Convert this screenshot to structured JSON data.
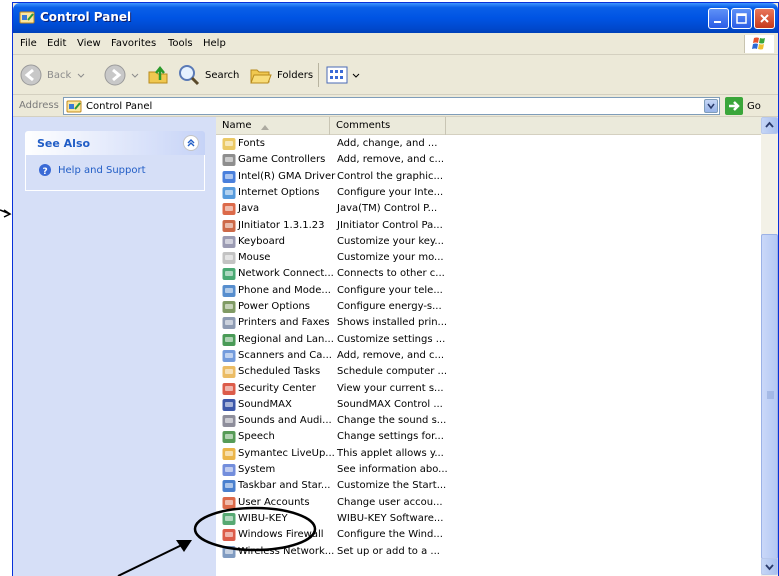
{
  "window": {
    "title": "Control Panel"
  },
  "menu": [
    "File",
    "Edit",
    "View",
    "Favorites",
    "Tools",
    "Help"
  ],
  "toolbar": {
    "back": "Back",
    "search": "Search",
    "folders": "Folders"
  },
  "address": {
    "label": "Address",
    "value": "Control Panel",
    "go": "Go"
  },
  "see_also": {
    "title": "See Also",
    "links": [
      "Help and Support"
    ]
  },
  "columns": {
    "name": "Name",
    "comments": "Comments"
  },
  "items": [
    {
      "name": "Fonts",
      "comment": "Add, change, and ...",
      "icon": "fonts-icon",
      "color": "#e8c04a"
    },
    {
      "name": "Game Controllers",
      "comment": "Add, remove, and c...",
      "icon": "game-controller-icon",
      "color": "#7a7a7a"
    },
    {
      "name": "Intel(R) GMA Driver",
      "comment": "Control the graphic...",
      "icon": "intel-gma-icon",
      "color": "#2a6ad6"
    },
    {
      "name": "Internet Options",
      "comment": "Configure your Inte...",
      "icon": "internet-options-icon",
      "color": "#3a8ad6"
    },
    {
      "name": "Java",
      "comment": "Java(TM) Control P...",
      "icon": "java-icon",
      "color": "#d6502a"
    },
    {
      "name": "JInitiator 1.3.1.23",
      "comment": "JInitiator Control Pa...",
      "icon": "jinitiator-icon",
      "color": "#c4502a"
    },
    {
      "name": "Keyboard",
      "comment": "Customize your key...",
      "icon": "keyboard-icon",
      "color": "#8a8aa6"
    },
    {
      "name": "Mouse",
      "comment": "Customize your mo...",
      "icon": "mouse-icon",
      "color": "#b8b8b8"
    },
    {
      "name": "Network Connect...",
      "comment": "Connects to other c...",
      "icon": "network-connections-icon",
      "color": "#2a9a5a"
    },
    {
      "name": "Phone and Mode...",
      "comment": "Configure your tele...",
      "icon": "phone-modem-icon",
      "color": "#3a7ac6"
    },
    {
      "name": "Power Options",
      "comment": "Configure energy-s...",
      "icon": "power-options-icon",
      "color": "#6a8a4a"
    },
    {
      "name": "Printers and Faxes",
      "comment": "Shows installed prin...",
      "icon": "printers-icon",
      "color": "#7a8aa6"
    },
    {
      "name": "Regional and Lan...",
      "comment": "Customize settings ...",
      "icon": "regional-language-icon",
      "color": "#2a8a3a"
    },
    {
      "name": "Scanners and Ca...",
      "comment": "Add, remove, and c...",
      "icon": "scanners-cameras-icon",
      "color": "#5a8ad6"
    },
    {
      "name": "Scheduled Tasks",
      "comment": "Schedule computer ...",
      "icon": "scheduled-tasks-icon",
      "color": "#e8b04a"
    },
    {
      "name": "Security Center",
      "comment": "View your current s...",
      "icon": "security-center-icon",
      "color": "#d6402a"
    },
    {
      "name": "SoundMAX",
      "comment": "SoundMAX Control ...",
      "icon": "soundmax-icon",
      "color": "#1a3a9a"
    },
    {
      "name": "Sounds and Audi...",
      "comment": "Change the sound s...",
      "icon": "sounds-audio-icon",
      "color": "#7a7a8a"
    },
    {
      "name": "Speech",
      "comment": "Change settings for...",
      "icon": "speech-icon",
      "color": "#3a8a3a"
    },
    {
      "name": "Symantec LiveUp...",
      "comment": "This applet allows y...",
      "icon": "symantec-liveupdate-icon",
      "color": "#e8a82a"
    },
    {
      "name": "System",
      "comment": "See information abo...",
      "icon": "system-icon",
      "color": "#5a7ad6"
    },
    {
      "name": "Taskbar and Star...",
      "comment": "Customize the Start...",
      "icon": "taskbar-start-icon",
      "color": "#2a6ac6"
    },
    {
      "name": "User Accounts",
      "comment": "Change user accou...",
      "icon": "user-accounts-icon",
      "color": "#d6502a"
    },
    {
      "name": "WIBU-KEY",
      "comment": "WIBU-KEY Software...",
      "icon": "wibu-key-icon",
      "color": "#3a9a5a"
    },
    {
      "name": "Windows Firewall",
      "comment": "Configure the Wind...",
      "icon": "windows-firewall-icon",
      "color": "#d6402a"
    },
    {
      "name": "Wireless Network...",
      "comment": "Set up or add to a ...",
      "icon": "wireless-network-icon",
      "color": "#6a8ab6"
    }
  ]
}
